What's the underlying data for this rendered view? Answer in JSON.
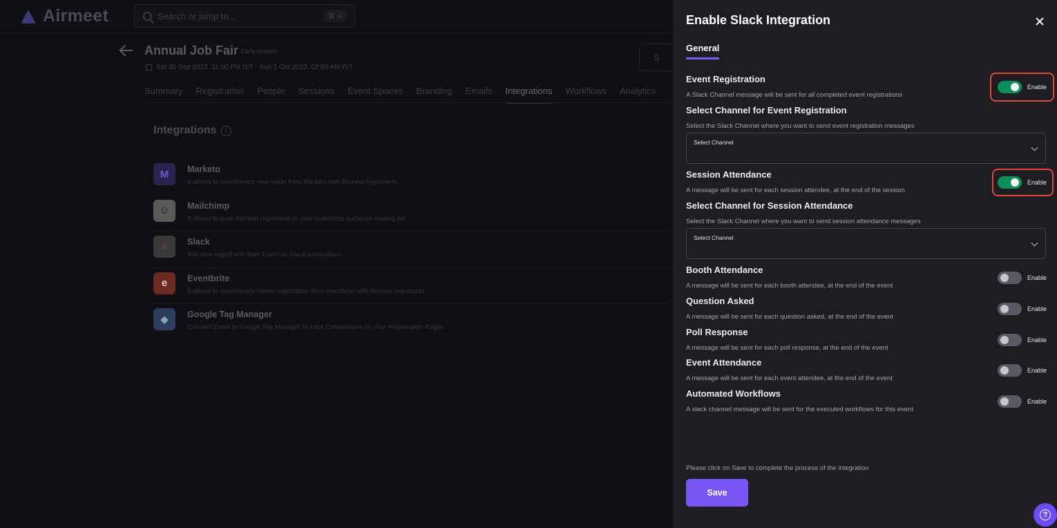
{
  "app": {
    "logo_text": "Airmeet",
    "search_placeholder": "Search or jump to...",
    "search_shortcut": "⌘ K"
  },
  "event": {
    "title": "Annual Job Fair",
    "badge": "Early Access",
    "date_range": "Sat 30 Sep 2023, 11:00 PM IST - Sun 1 Oct 2023, 02:00 AM IST",
    "share_label": "S"
  },
  "tabs": [
    {
      "label": "Summary",
      "active": false
    },
    {
      "label": "Registration",
      "active": false
    },
    {
      "label": "People",
      "active": false
    },
    {
      "label": "Sessions",
      "active": false
    },
    {
      "label": "Event Spaces",
      "active": false
    },
    {
      "label": "Branding",
      "active": false
    },
    {
      "label": "Emails",
      "active": false
    },
    {
      "label": "Integrations",
      "active": true
    },
    {
      "label": "Workflows",
      "active": false
    },
    {
      "label": "Analytics",
      "active": false
    }
  ],
  "integrations": {
    "heading": "Integrations",
    "info_glyph": "i",
    "items": [
      {
        "name": "Marketo",
        "desc": "It allows to synchronize new leads from Marketo with Airmeet registrants.",
        "icon": "marketo-logo",
        "color": "#2a2350",
        "glyph": "M"
      },
      {
        "name": "Mailchimp",
        "desc": "It allows to push Airmeet registrants to your mailchimp audience mailing list",
        "icon": "mailchimp-logo",
        "color": "#5a5a5a",
        "glyph": "☺"
      },
      {
        "name": "Slack",
        "desc": "Add new registrants from Event as Slack subscribers",
        "icon": "slack-logo",
        "color": "#3a3a3a",
        "glyph": "#"
      },
      {
        "name": "Eventbrite",
        "desc": "It allows to synchronize newer registration from eventbrite with Airmeet registrants",
        "icon": "eventbrite-logo",
        "color": "#6b2a22",
        "glyph": "e"
      },
      {
        "name": "Google Tag Manager",
        "desc": "Connect Event to Google Tag Manager to track Conversions on Your Registration Pages",
        "icon": "google-tag-manager-logo",
        "color": "#2c3d5e",
        "glyph": "◆"
      }
    ]
  },
  "drawer": {
    "title": "Enable Slack Integration",
    "tab_general": "General",
    "toggle_label": "Enable",
    "select_placeholder": "Select Channel",
    "sections": {
      "event_registration": {
        "title": "Event Registration",
        "desc": "A Slack Channel message will be sent for all completed event registrations",
        "enabled": true
      },
      "select_event_registration": {
        "title": "Select Channel for Event Registration",
        "desc": "Select the Slack Channel where you want to send event registration messages"
      },
      "session_attendance": {
        "title": "Session Attendance",
        "desc": "A message will be sent for each session attendee, at the end of the session",
        "enabled": true
      },
      "select_session_attendance": {
        "title": "Select Channel for Session Attendance",
        "desc": "Select the Slack Channel where you want to send session attendance messages"
      },
      "booth_attendance": {
        "title": "Booth Attendance",
        "desc": "A message will be sent for each booth attendee, at the end of the event",
        "enabled": false
      },
      "question_asked": {
        "title": "Question Asked",
        "desc": "A message will be sent for each question asked, at the end of the event",
        "enabled": false
      },
      "poll_response": {
        "title": "Poll Response",
        "desc": "A message will be sent for each poll response, at the end of the event",
        "enabled": false
      },
      "event_attendance": {
        "title": "Event Attendance",
        "desc": "A message will be sent for each event attendee, at the end of the event",
        "enabled": false
      },
      "automated_workflows": {
        "title": "Automated Workflows",
        "desc": "A slack channel message will be sent for the executed workflows for this event",
        "enabled": false
      }
    },
    "footer_note": "Please click on Save to complete the process of the integration",
    "save_label": "Save",
    "help_glyph": "?"
  },
  "colors": {
    "accent": "#7a55f6",
    "toggle_on": "#0c8f5c",
    "highlight": "#e04848",
    "drawer_bg": "#1d1d22"
  }
}
